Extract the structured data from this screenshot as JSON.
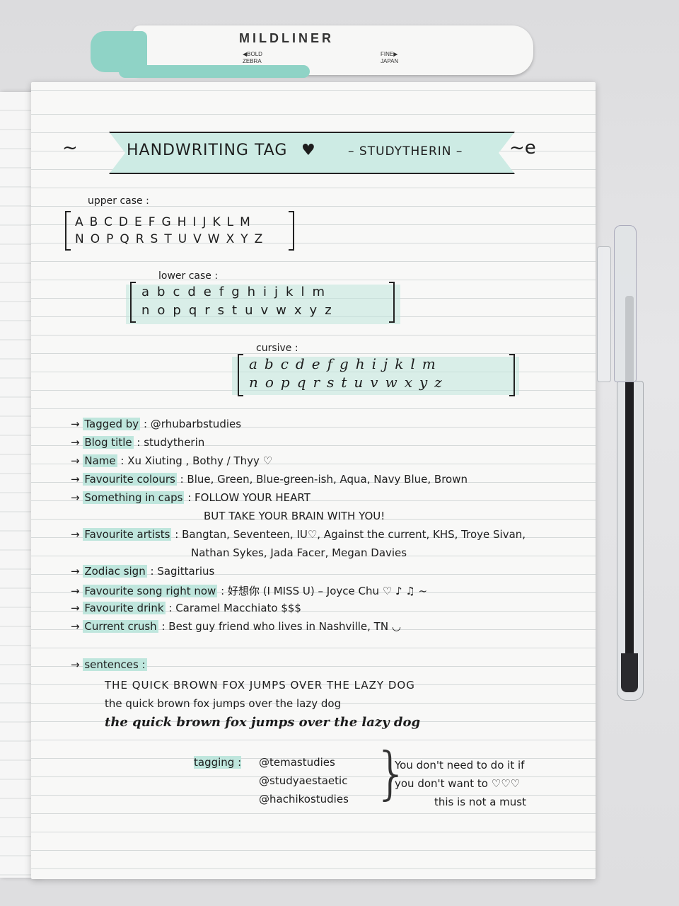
{
  "highlighter": {
    "brand": "MILDLINER",
    "bold_label": "◀BOLD",
    "fine_label": "FINE▶",
    "maker": "ZEBRA",
    "origin": "JAPAN"
  },
  "header": {
    "title": "HANDWRITING TAG",
    "heart": "♥",
    "byline": "– STUDYTHERIN –",
    "swirl_left": "~",
    "swirl_right": "~e"
  },
  "alphabets": {
    "upper_label": "upper case :",
    "upper_row1": "ABCDEFGHIJKLM",
    "upper_row2": "NOPQRSTUVWXYZ",
    "lower_label": "lower case :",
    "lower_row1": "abcdefghijklm",
    "lower_row2": "nopqrstuvwxyz",
    "cursive_label": "cursive :",
    "cursive_row1": "abcdefghijklm",
    "cursive_row2": "nopqrstuvwxyz"
  },
  "entries": [
    {
      "key": "Tagged by",
      "value": ": @rhubarbstudies"
    },
    {
      "key": "Blog title",
      "value": ": studytherin"
    },
    {
      "key": "Name",
      "value": ": Xu Xiuting , Bothy / Thyy ♡"
    },
    {
      "key": "Favourite colours",
      "value": ": Blue, Green, Blue-green-ish, Aqua, Navy Blue, Brown"
    },
    {
      "key": "Something in caps",
      "value": ": FOLLOW YOUR HEART"
    },
    {
      "key": "",
      "value": "BUT TAKE YOUR BRAIN WITH YOU!"
    },
    {
      "key": "Favourite artists",
      "value": ": Bangtan, Seventeen, IU♡, Against the current, KHS, Troye Sivan,"
    },
    {
      "key": "",
      "value": "Nathan Sykes, Jada Facer, Megan Davies"
    },
    {
      "key": "Zodiac sign",
      "value": ": Sagittarius"
    },
    {
      "key": "Favourite song right now",
      "value": ": 好想你 (I MISS U) – Joyce Chu ♡ ♪ ♫ ~"
    },
    {
      "key": "Favourite drink",
      "value": ": Caramel Macchiato $$$"
    },
    {
      "key": "Current crush",
      "value": ": Best guy friend who lives in Nashville, TN ◡"
    }
  ],
  "sentences": {
    "label": "sentences :",
    "line1": "THE QUICK BROWN FOX JUMPS OVER THE LAZY DOG",
    "line2": "the quick brown fox jumps over the lazy dog",
    "line3": "the quick brown fox jumps over the lazy dog"
  },
  "tagging": {
    "label": "tagging :",
    "names": [
      "@temastudies",
      "@studyaestaetic",
      "@hachikostudies"
    ],
    "note1": "You don't need to do it if",
    "note2": "you don't want to ♡♡♡",
    "note3": "this is not a must"
  }
}
